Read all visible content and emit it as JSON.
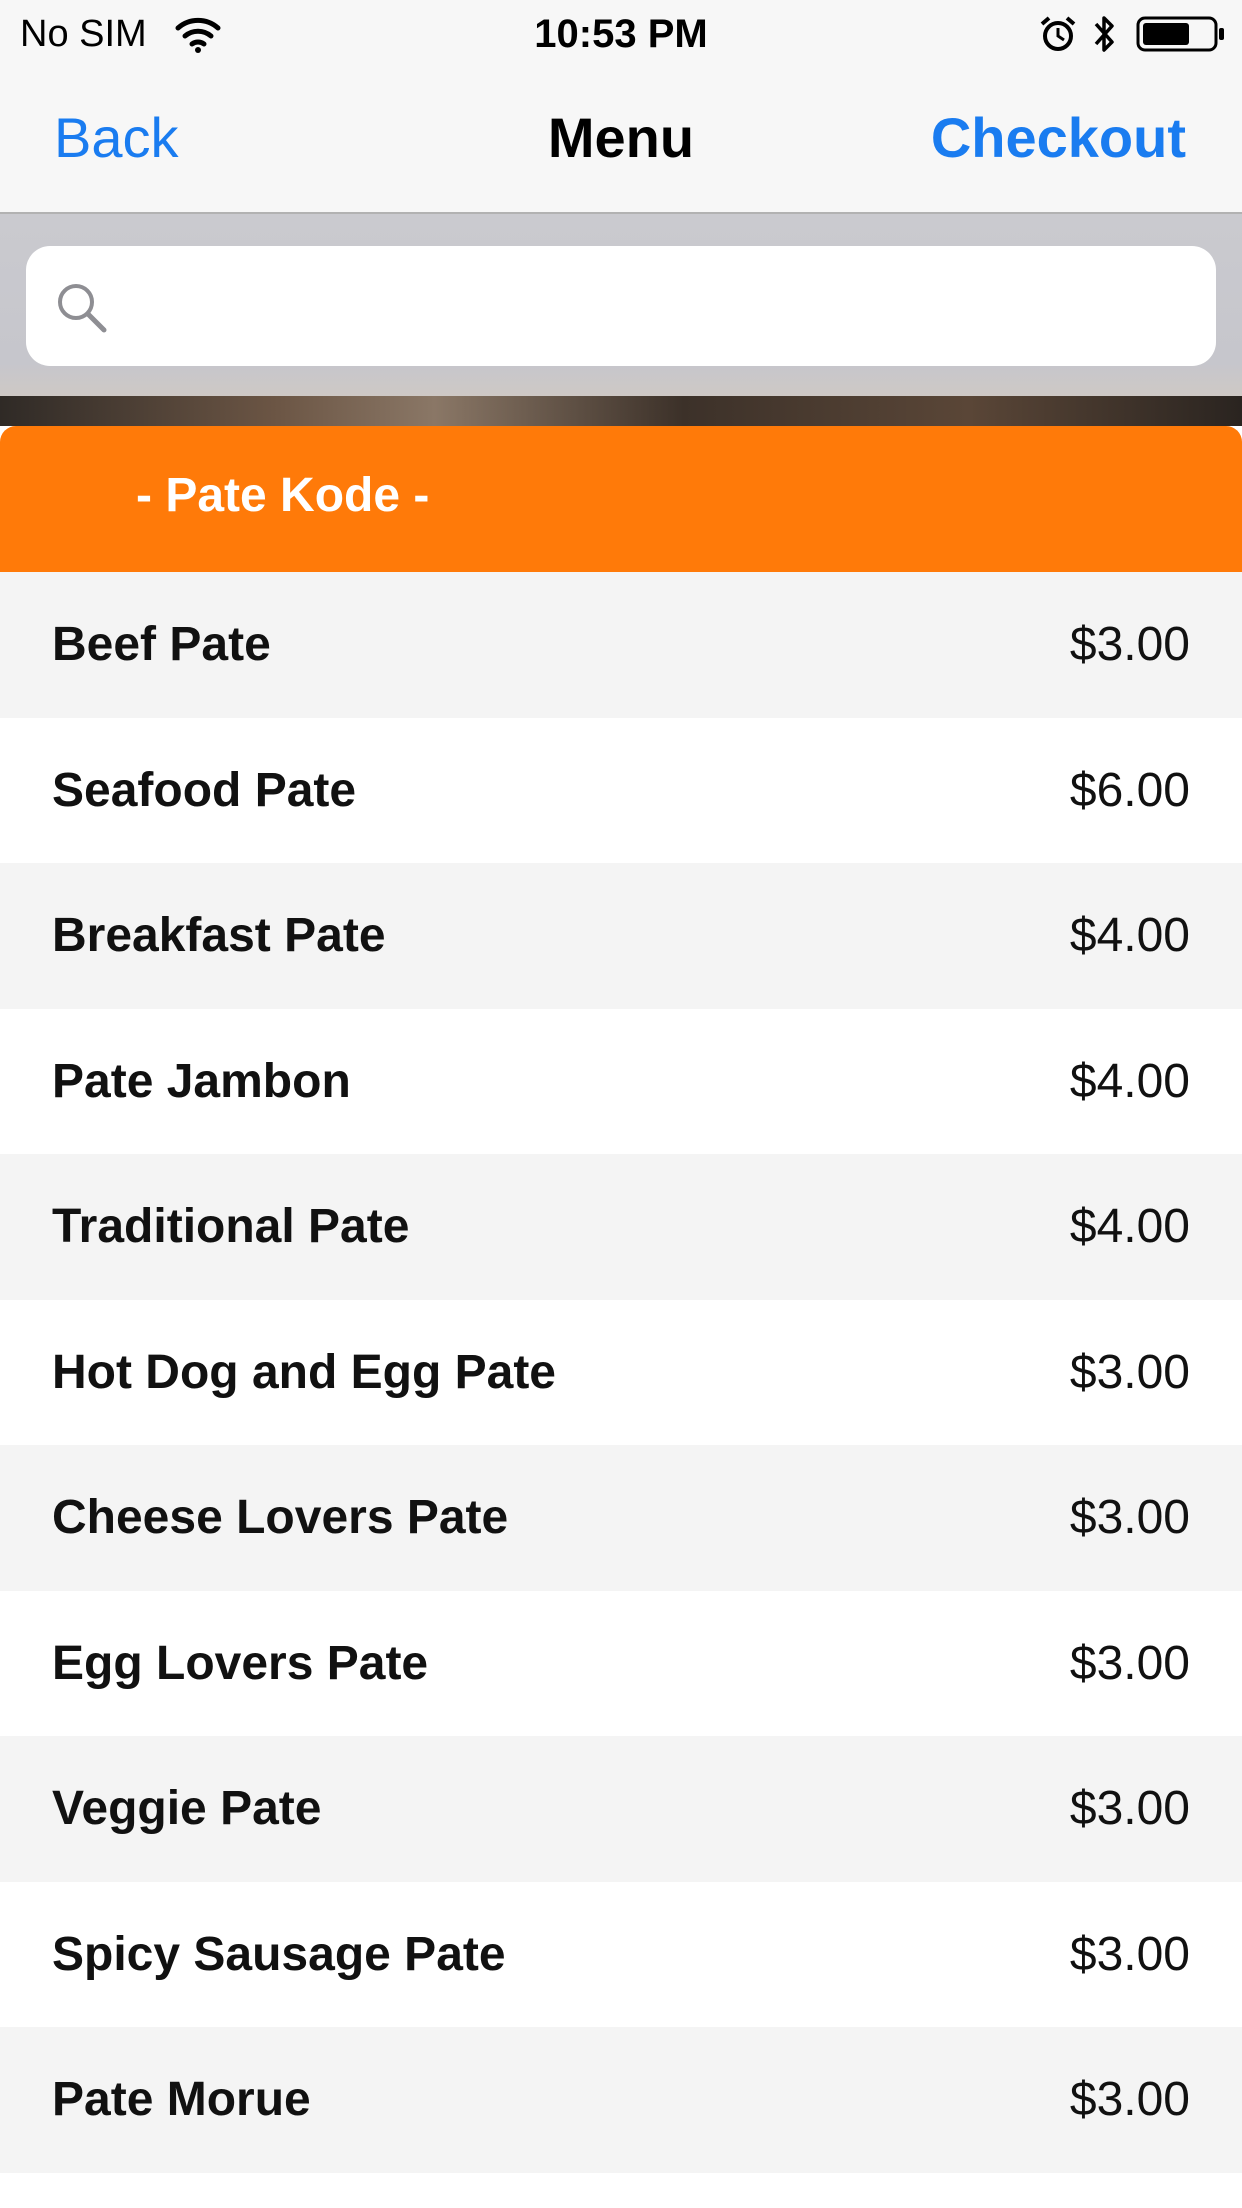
{
  "status_bar": {
    "carrier": "No SIM",
    "time": "10:53 PM",
    "icons": [
      "wifi-icon",
      "alarm-icon",
      "bluetooth-icon",
      "battery-icon"
    ]
  },
  "nav": {
    "back_label": "Back",
    "title": "Menu",
    "checkout_label": "Checkout"
  },
  "search": {
    "value": "",
    "placeholder": "",
    "icon": "search-icon"
  },
  "category": {
    "label": "- Pate Kode -"
  },
  "menu_items": [
    {
      "name": "Beef Pate",
      "price": "$3.00"
    },
    {
      "name": "Seafood Pate",
      "price": "$6.00"
    },
    {
      "name": "Breakfast Pate",
      "price": "$4.00"
    },
    {
      "name": "Pate Jambon",
      "price": "$4.00"
    },
    {
      "name": "Traditional Pate",
      "price": "$4.00"
    },
    {
      "name": "Hot Dog and Egg Pate",
      "price": "$3.00"
    },
    {
      "name": "Cheese Lovers Pate",
      "price": "$3.00"
    },
    {
      "name": "Egg Lovers Pate",
      "price": "$3.00"
    },
    {
      "name": "Veggie Pate",
      "price": "$3.00"
    },
    {
      "name": "Spicy Sausage Pate",
      "price": "$3.00"
    },
    {
      "name": "Pate Morue",
      "price": "$3.00"
    }
  ],
  "colors": {
    "accent": "#1a7cf0",
    "category_bg": "#ff7a09",
    "row_shade": "#f4f4f4",
    "row_plain": "#ffffff"
  }
}
